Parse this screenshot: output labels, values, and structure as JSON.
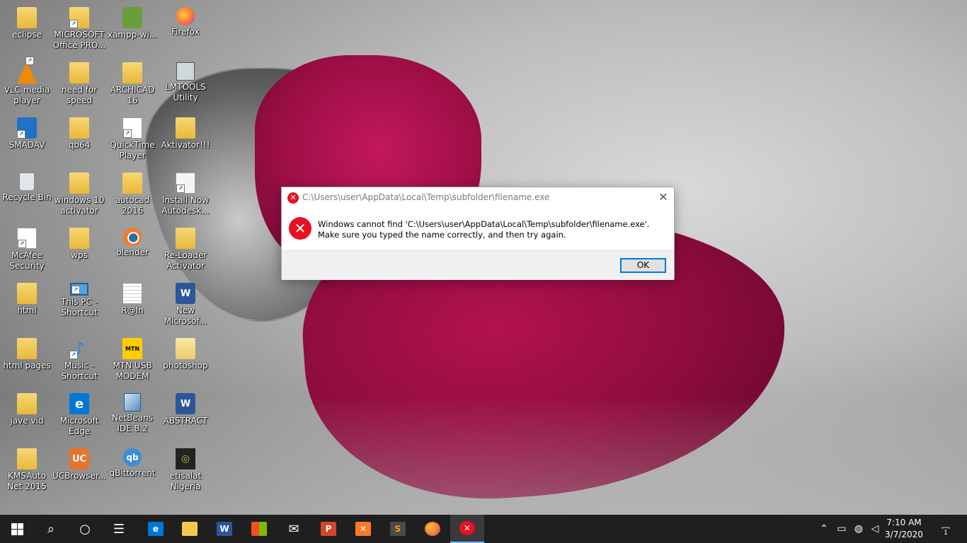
{
  "desktop_icons": [
    {
      "label": "eclipse",
      "icon": "folder-icon"
    },
    {
      "label": "MICROSOFT Office PRO...",
      "icon": "folder-icon"
    },
    {
      "label": "xampp-wi...",
      "icon": "installer-icon"
    },
    {
      "label": "Firefox",
      "icon": "firefox-icon"
    },
    {
      "label": "VLC media player",
      "icon": "vlc-icon"
    },
    {
      "label": "need for speed",
      "icon": "folder-icon"
    },
    {
      "label": "ARCHICAD 16",
      "icon": "folder-icon"
    },
    {
      "label": "LMTOOLS Utility",
      "icon": "lmtools-icon"
    },
    {
      "label": "SMADAV",
      "icon": "smadav-icon"
    },
    {
      "label": "qb64",
      "icon": "folder-icon"
    },
    {
      "label": "QuickTime Player",
      "icon": "document-icon"
    },
    {
      "label": "Aktivator!!!",
      "icon": "folder-icon"
    },
    {
      "label": "Recycle Bin",
      "icon": "recycle-bin-icon"
    },
    {
      "label": "windows 10 activator",
      "icon": "folder-icon"
    },
    {
      "label": "autocad 2016",
      "icon": "folder-icon"
    },
    {
      "label": "Install Now Autodesk...",
      "icon": "autodesk-icon"
    },
    {
      "label": "McAfee Security Sc...",
      "icon": "document-icon"
    },
    {
      "label": "wps",
      "icon": "folder-icon"
    },
    {
      "label": "blender",
      "icon": "blender-icon"
    },
    {
      "label": "Re-Loader Activator 3...",
      "icon": "folder-icon"
    },
    {
      "label": "html",
      "icon": "folder-icon"
    },
    {
      "label": "This PC - Shortcut",
      "icon": "this-pc-icon"
    },
    {
      "label": "R@In",
      "icon": "text-file-icon"
    },
    {
      "label": "New Microsof...",
      "icon": "word-doc-icon"
    },
    {
      "label": "html pages",
      "icon": "folder-icon"
    },
    {
      "label": "Music - Shortcut",
      "icon": "music-icon"
    },
    {
      "label": "MTN USB MODEM",
      "icon": "mtn-icon"
    },
    {
      "label": "photoshop",
      "icon": "folder-icon"
    },
    {
      "label": "jave vid",
      "icon": "folder-icon"
    },
    {
      "label": "Microsoft Edge",
      "icon": "edge-icon"
    },
    {
      "label": "NetBeans IDE 8.2",
      "icon": "netbeans-icon"
    },
    {
      "label": "ABSTRACT",
      "icon": "word-doc-icon"
    },
    {
      "label": "KMSAuto Net 2015 v...",
      "icon": "folder-icon"
    },
    {
      "label": "UCBrowser...",
      "icon": "ucbrowser-icon"
    },
    {
      "label": "qBittorrent",
      "icon": "qbittorrent-icon"
    },
    {
      "label": "etisalat Nigeria",
      "icon": "etisalat-icon"
    }
  ],
  "dialog": {
    "title": "C:\\Users\\user\\AppData\\Local\\Temp\\subfolder\\filename.exe",
    "message": "Windows cannot find 'C:\\Users\\user\\AppData\\Local\\Temp\\subfolder\\filename.exe'. Make sure you typed the name correctly, and then try again.",
    "ok_label": "OK",
    "close_glyph": "✕",
    "error_glyph": "✕"
  },
  "taskbar": {
    "items": [
      "start-button",
      "search-icon",
      "cortana-icon",
      "task-view-icon",
      "edge-icon",
      "file-explorer-icon",
      "word-icon",
      "store-icon",
      "mail-icon",
      "powerpoint-icon",
      "xampp-icon",
      "sublime-text-icon",
      "firefox-icon",
      "error-dialog-app-icon"
    ],
    "time": "7:10 AM",
    "date": "3/7/2020",
    "notification_count": "1"
  },
  "colors": {
    "taskbar_bg": "#1f1f1f",
    "error_red": "#e81123",
    "accent_blue": "#0078d7",
    "dialog_footer": "#f0f0f0"
  }
}
